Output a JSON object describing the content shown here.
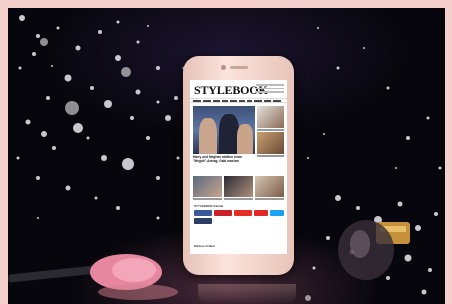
{
  "scene": {
    "description_colors": {
      "background": "#07060c",
      "frame": "#f4cfcb",
      "phone_body": "#f6d6cc"
    }
  },
  "site": {
    "title": "STYLEBOOK",
    "hero_caption": "Harry und Meghan stellten einen \"Megxit\"-Antrag. Gabi machen",
    "section_label": "STYLEBOOK Kanäle",
    "bottom_label": "Weitere Artikel"
  }
}
